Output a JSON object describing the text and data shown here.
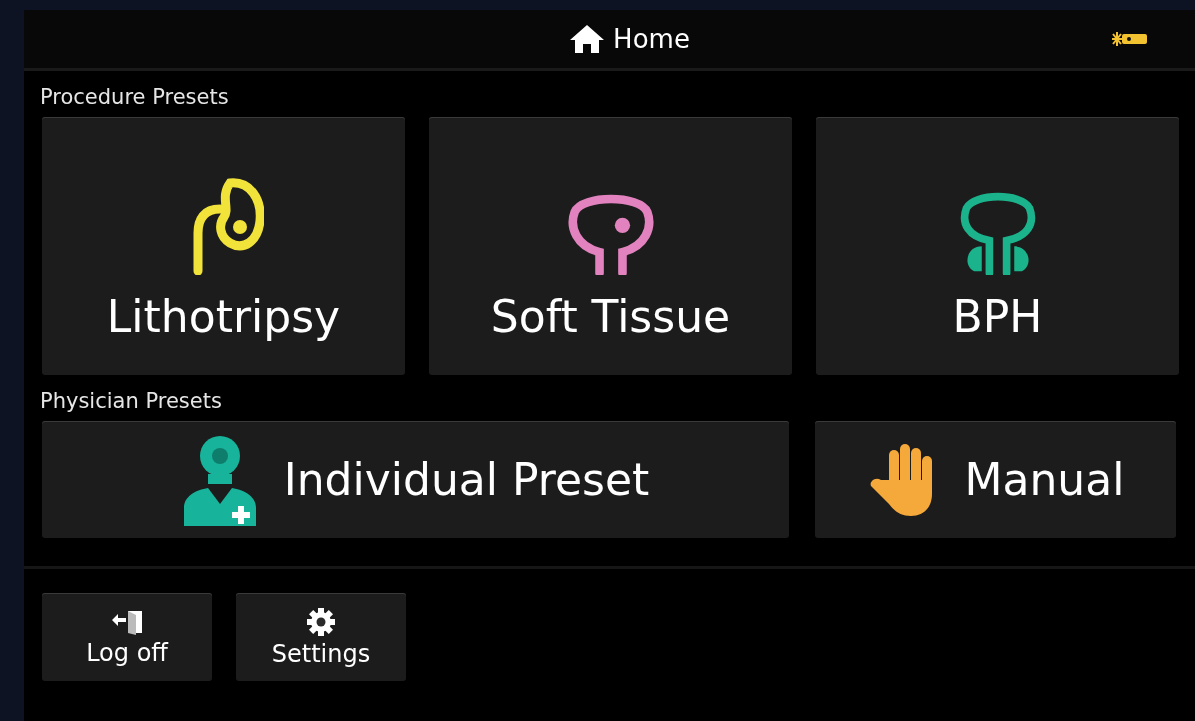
{
  "header": {
    "title": "Home"
  },
  "procedure_presets": {
    "label": "Procedure Presets",
    "items": [
      {
        "label": "Lithotripsy",
        "kind": "kidney",
        "color": "#f2e33a"
      },
      {
        "label": "Soft Tissue",
        "kind": "bladder",
        "color": "#e283bf"
      },
      {
        "label": "BPH",
        "kind": "prostate",
        "color": "#1bb38b"
      }
    ]
  },
  "physician_presets": {
    "label": "Physician Presets",
    "items": [
      {
        "label": "Individual Preset",
        "kind": "physician"
      },
      {
        "label": "Manual",
        "kind": "hand"
      }
    ]
  },
  "footer_buttons": [
    {
      "label": "Log off",
      "kind": "logoff"
    },
    {
      "label": "Settings",
      "kind": "settings"
    }
  ]
}
